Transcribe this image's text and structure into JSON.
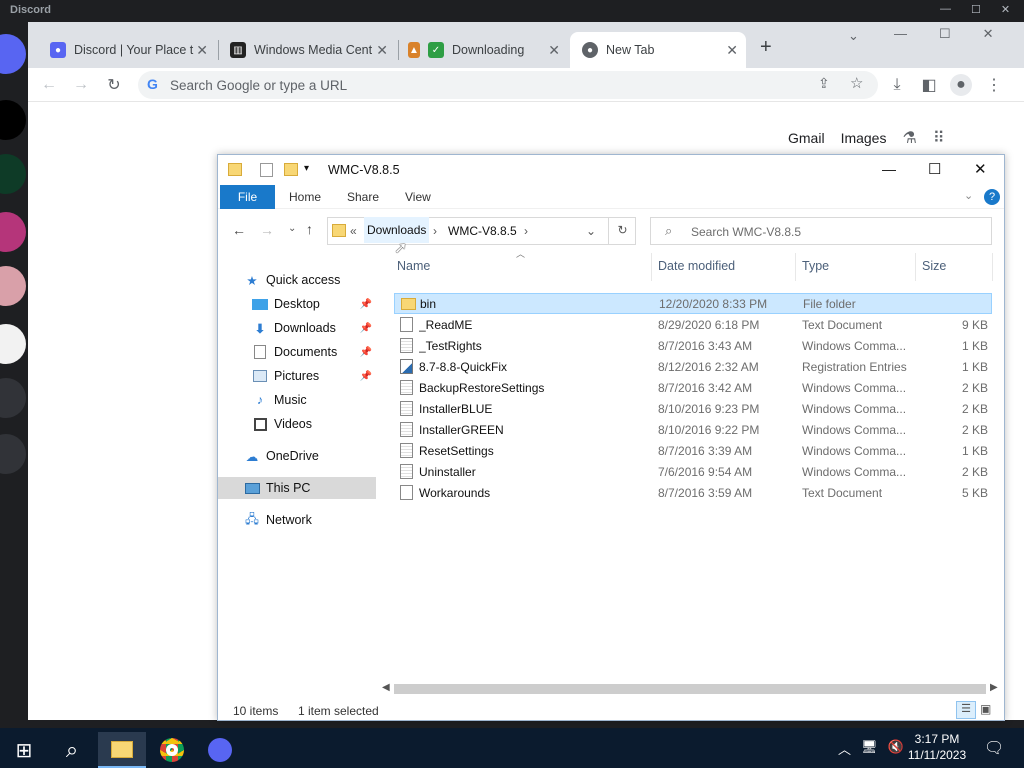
{
  "discord": {
    "title": "Discord"
  },
  "browser": {
    "tabs": [
      {
        "label": "Discord | Your Place t"
      },
      {
        "label": "Windows Media Cent"
      },
      {
        "label": "Downloading"
      },
      {
        "label": "New Tab"
      }
    ],
    "new_tab_symbol": "+",
    "omnibox_placeholder": "Search Google or type a URL",
    "ntp": {
      "gmail": "Gmail",
      "images": "Images"
    }
  },
  "explorer": {
    "title": "WMC-V8.8.5",
    "ribbon": {
      "file": "File",
      "home": "Home",
      "share": "Share",
      "view": "View"
    },
    "address": {
      "root_chevron": "«",
      "crumbs": [
        "Downloads",
        "WMC-V8.8.5"
      ]
    },
    "search_placeholder": "Search WMC-V8.8.5",
    "nav": {
      "quick_access": "Quick access",
      "desktop": "Desktop",
      "downloads": "Downloads",
      "documents": "Documents",
      "pictures": "Pictures",
      "music": "Music",
      "videos": "Videos",
      "onedrive": "OneDrive",
      "this_pc": "This PC",
      "network": "Network"
    },
    "columns": {
      "name": "Name",
      "date": "Date modified",
      "type": "Type",
      "size": "Size"
    },
    "files": [
      {
        "name": "bin",
        "date": "12/20/2020 8:33 PM",
        "type": "File folder",
        "size": "",
        "icon": "folder-icon"
      },
      {
        "name": "_ReadME",
        "date": "8/29/2020 6:18 PM",
        "type": "Text Document",
        "size": "9 KB",
        "icon": "text-file-icon"
      },
      {
        "name": "_TestRights",
        "date": "8/7/2016 3:43 AM",
        "type": "Windows Comma...",
        "size": "1 KB",
        "icon": "cmd-file-icon"
      },
      {
        "name": "8.7-8.8-QuickFix",
        "date": "8/12/2016 2:32 AM",
        "type": "Registration Entries",
        "size": "1 KB",
        "icon": "reg-file-icon"
      },
      {
        "name": "BackupRestoreSettings",
        "date": "8/7/2016 3:42 AM",
        "type": "Windows Comma...",
        "size": "2 KB",
        "icon": "cmd-file-icon"
      },
      {
        "name": "InstallerBLUE",
        "date": "8/10/2016 9:23 PM",
        "type": "Windows Comma...",
        "size": "2 KB",
        "icon": "cmd-file-icon"
      },
      {
        "name": "InstallerGREEN",
        "date": "8/10/2016 9:22 PM",
        "type": "Windows Comma...",
        "size": "2 KB",
        "icon": "cmd-file-icon"
      },
      {
        "name": "ResetSettings",
        "date": "8/7/2016 3:39 AM",
        "type": "Windows Comma...",
        "size": "1 KB",
        "icon": "cmd-file-icon"
      },
      {
        "name": "Uninstaller",
        "date": "7/6/2016 9:54 AM",
        "type": "Windows Comma...",
        "size": "2 KB",
        "icon": "cmd-file-icon"
      },
      {
        "name": "Workarounds",
        "date": "8/7/2016 3:59 AM",
        "type": "Text Document",
        "size": "5 KB",
        "icon": "text-file-icon"
      }
    ],
    "selected_index": 0,
    "status": {
      "items": "10 items",
      "selected": "1 item selected"
    }
  },
  "taskbar": {
    "time": "3:17 PM",
    "date": "11/11/2023"
  },
  "colors": {
    "accent": "#1979ca",
    "selection": "#cce8ff",
    "taskbar": "#0b1b2e",
    "folder": "#f8d775"
  }
}
